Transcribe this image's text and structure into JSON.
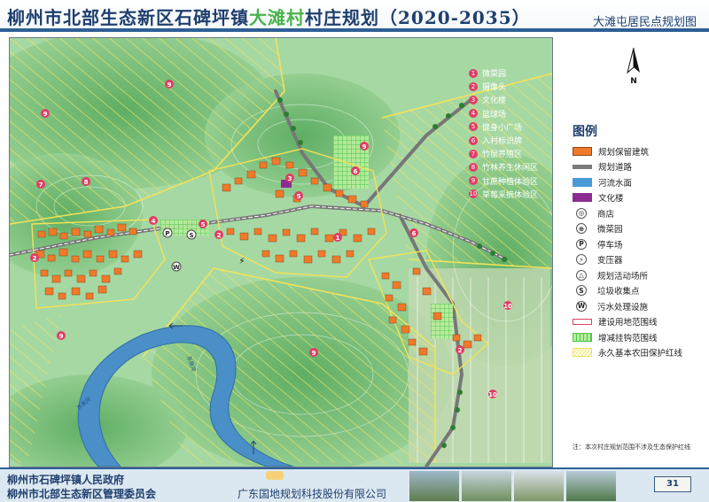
{
  "header": {
    "title_pre": "柳州市北部生态新区石碑坪镇",
    "title_highlight": "大滩村",
    "title_post": "村庄规划（2020-2035）",
    "subtitle": "大滩屯居民点规划图"
  },
  "map": {
    "numbered_list": [
      {
        "num": "1",
        "label": "微菜园"
      },
      {
        "num": "2",
        "label": "摄像头"
      },
      {
        "num": "3",
        "label": "文化楼"
      },
      {
        "num": "4",
        "label": "篮球场"
      },
      {
        "num": "5",
        "label": "健身小广场"
      },
      {
        "num": "6",
        "label": "入村标识牌"
      },
      {
        "num": "7",
        "label": "竹鼠养殖区"
      },
      {
        "num": "8",
        "label": "竹林养生休闲区"
      },
      {
        "num": "9",
        "label": "甘蔗种植体验区"
      },
      {
        "num": "10",
        "label": "草莓采摘体验区"
      }
    ],
    "river_labels": [
      "东泉河",
      "东泉河"
    ],
    "map_markers": [
      "9",
      "9",
      "8",
      "7",
      "9",
      "9",
      "9",
      "10",
      "10",
      "2",
      "2",
      "2",
      "5",
      "6",
      "6",
      "1",
      "3",
      "4",
      "S",
      "P",
      "W",
      "5",
      "6"
    ]
  },
  "legend": {
    "north_label": "N",
    "title": "图例",
    "items": [
      {
        "type": "swatch",
        "style": "orange",
        "label": "规划保留建筑"
      },
      {
        "type": "swatch",
        "style": "road",
        "label": "规划道路"
      },
      {
        "type": "swatch",
        "style": "water",
        "label": "河流水面"
      },
      {
        "type": "swatch",
        "style": "purple",
        "label": "文化楼"
      },
      {
        "type": "symbol",
        "glyph": "◎",
        "label": "商店"
      },
      {
        "type": "symbol",
        "glyph": "⊕",
        "label": "微菜园"
      },
      {
        "type": "symbol",
        "glyph": "P",
        "label": "停车场"
      },
      {
        "type": "symbol",
        "glyph": "⚡",
        "label": "变压器"
      },
      {
        "type": "symbol",
        "glyph": "△",
        "label": "规划活动场所"
      },
      {
        "type": "symbol",
        "glyph": "S",
        "label": "垃圾收集点"
      },
      {
        "type": "symbol",
        "glyph": "W",
        "label": "污水处理设施"
      },
      {
        "type": "swatch",
        "style": "redline",
        "label": "建设用地范围线"
      },
      {
        "type": "swatch",
        "style": "greengrid",
        "label": "增减挂钩范围线"
      },
      {
        "type": "swatch",
        "style": "yellowhatch",
        "label": "永久基本农田保护红线"
      }
    ],
    "note": "注：本次村庄规划范围不涉及生态保护红线"
  },
  "footer": {
    "org1": "柳州市石碑坪镇人民政府",
    "org2": "柳州市北部生态新区管理委员会",
    "company": "广东国地规划科技股份有限公司",
    "logo_text": "国地科技",
    "page": "31"
  },
  "colors": {
    "title_blue": "#1f3f6e",
    "title_green": "#49b34a",
    "building_orange": "#f07a2a",
    "vegetation": "#7cc47e",
    "water": "#4a8fc7",
    "marker_pink": "#e03d64",
    "hatch_yellow": "#f3e65a"
  }
}
